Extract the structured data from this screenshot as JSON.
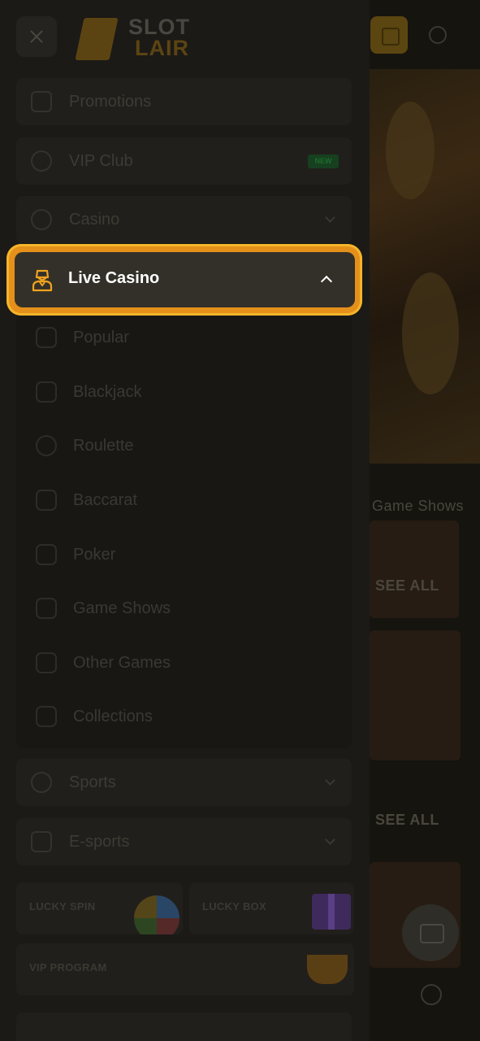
{
  "logo": {
    "top": "SLOT",
    "bottom": "LAIR"
  },
  "menu": {
    "promotions": "Promotions",
    "vip_club": "VIP Club",
    "vip_badge": "NEW",
    "casino": "Casino",
    "live_casino": "Live Casino",
    "sports": "Sports",
    "esports": "E-sports"
  },
  "live_sub": [
    "Popular",
    "Blackjack",
    "Roulette",
    "Baccarat",
    "Poker",
    "Game Shows",
    "Other Games",
    "Collections"
  ],
  "promos": {
    "lucky_spin": "LUCKY SPIN",
    "lucky_box": "LUCKY BOX",
    "vip_program": "VIP PROGRAM"
  },
  "background": {
    "section_label": "Game Shows",
    "see_all_1": "SEE ALL",
    "see_all_2": "SEE ALL"
  },
  "colors": {
    "accent": "#e4901a",
    "highlight_border": "#f5b52a"
  }
}
